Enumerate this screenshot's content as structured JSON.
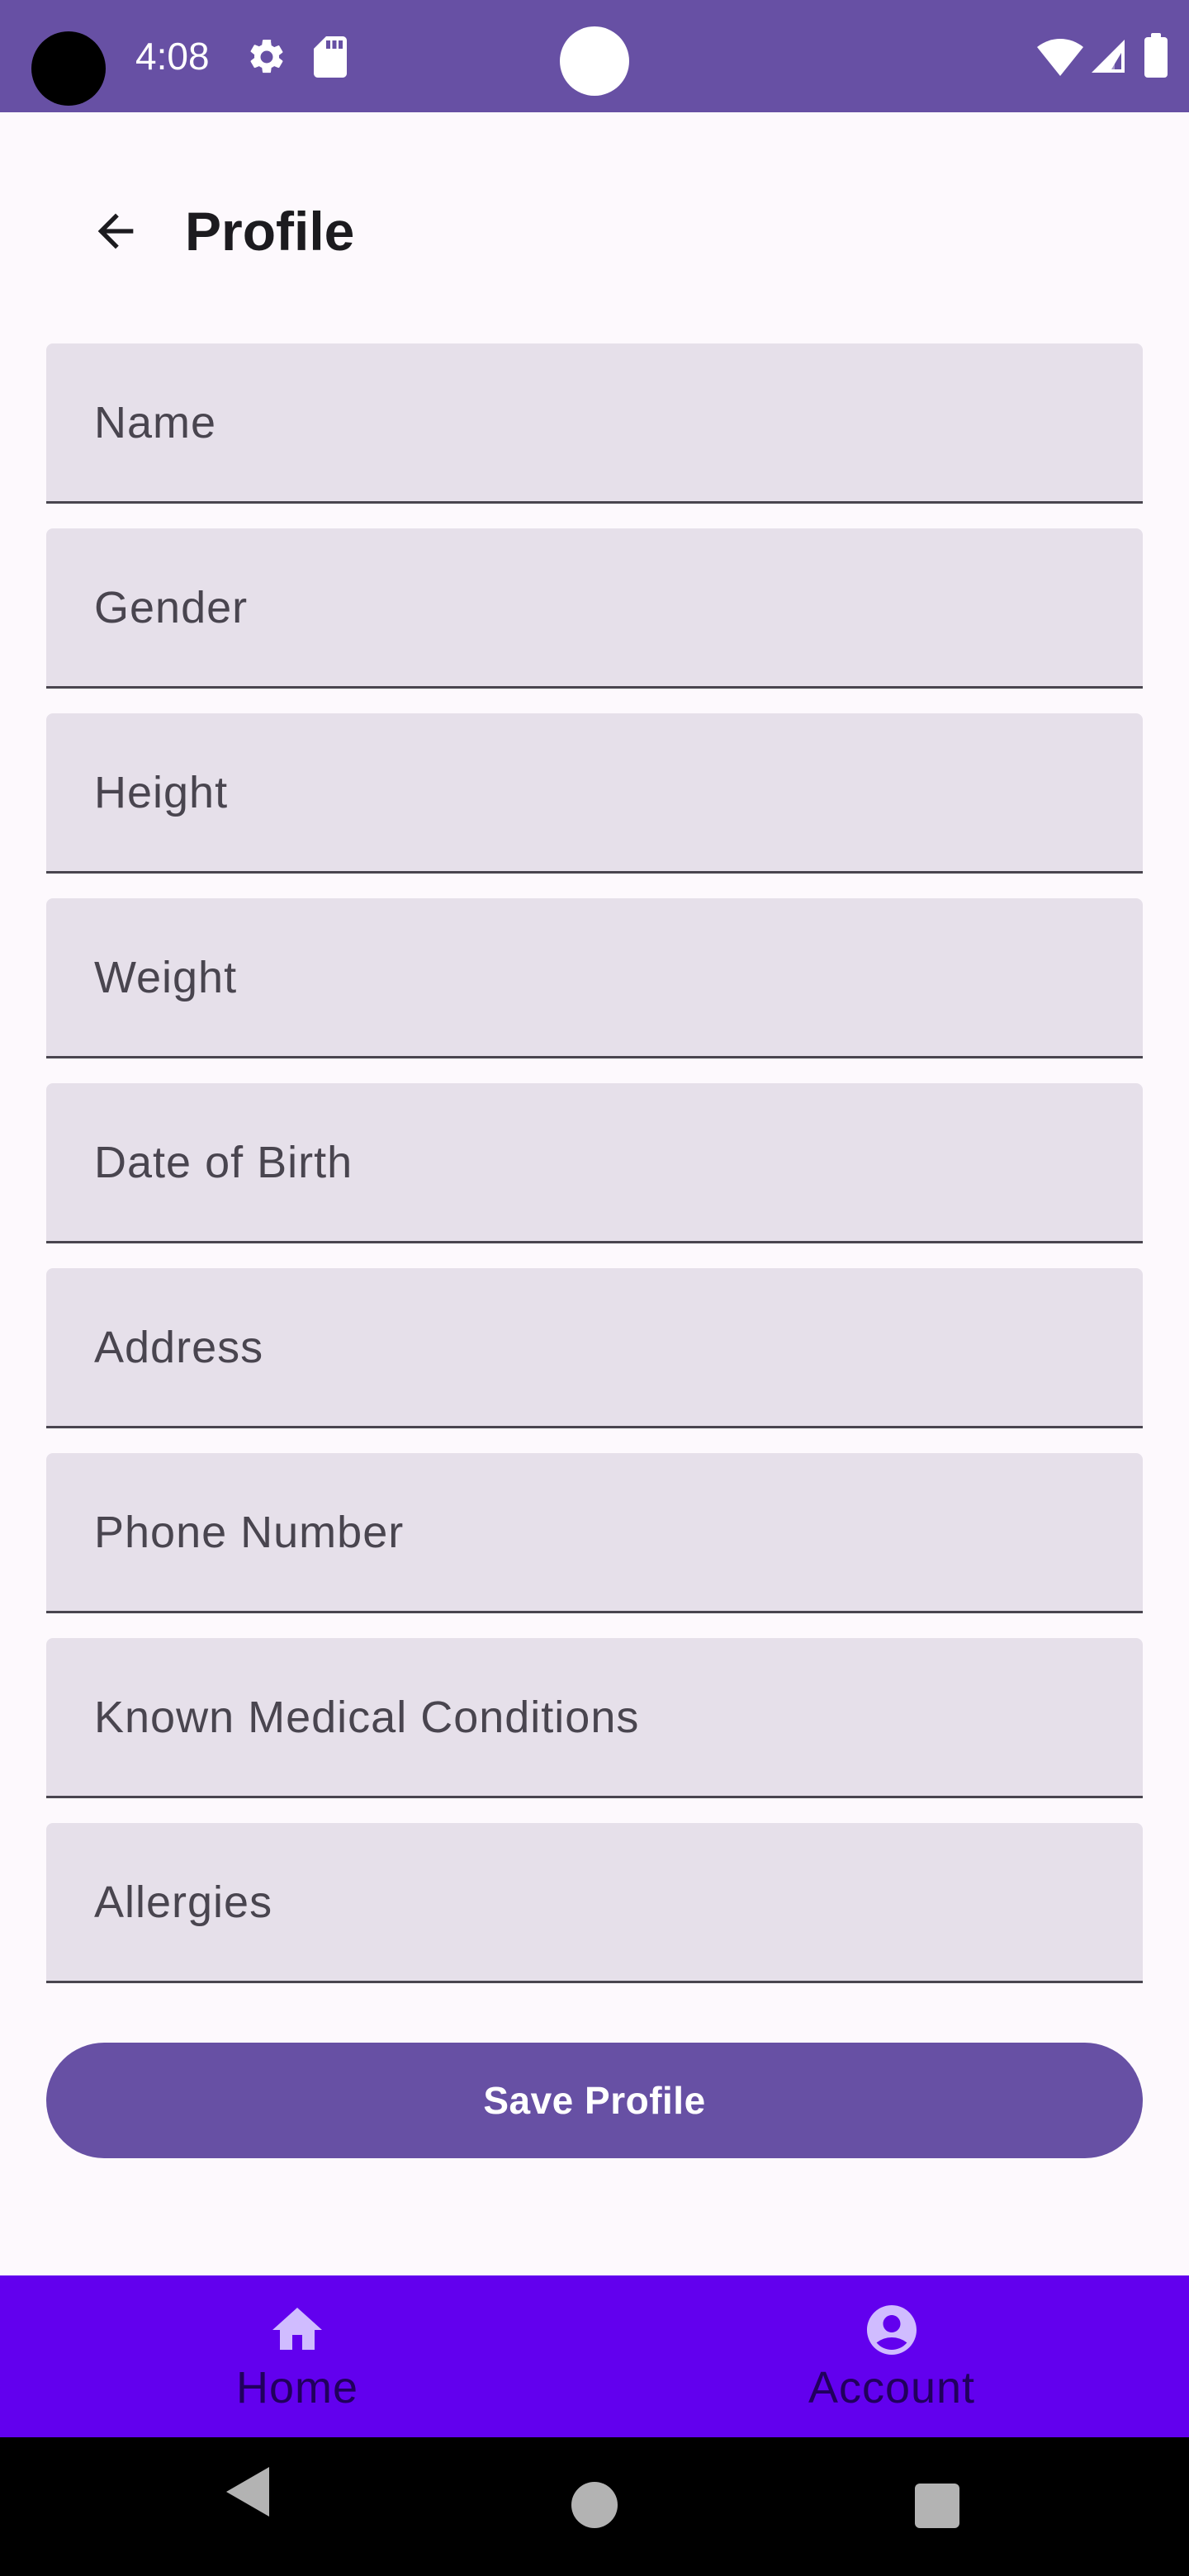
{
  "status_bar": {
    "time": "4:08",
    "icons": [
      "gear-icon",
      "sd-card-icon",
      "wifi-icon",
      "cell-signal-icon",
      "battery-icon"
    ]
  },
  "app_bar": {
    "title": "Profile",
    "back_icon": "arrow-back-icon"
  },
  "form": {
    "fields": [
      {
        "label": "Name"
      },
      {
        "label": "Gender"
      },
      {
        "label": "Height"
      },
      {
        "label": "Weight"
      },
      {
        "label": "Date of Birth"
      },
      {
        "label": "Address"
      },
      {
        "label": "Phone Number"
      },
      {
        "label": "Known Medical Conditions"
      },
      {
        "label": "Allergies"
      }
    ]
  },
  "save_button": {
    "label": "Save Profile"
  },
  "bottom_nav": {
    "items": [
      {
        "label": "Home",
        "icon": "home-icon"
      },
      {
        "label": "Account",
        "icon": "account-circle-icon"
      }
    ]
  },
  "colors": {
    "primary": "#6750a4",
    "nav_background": "#6200ee",
    "field_background": "#e6e0ea",
    "page_background": "#fdf9fd",
    "nav_icon": "#d0bcff",
    "nav_label": "#21005d"
  }
}
